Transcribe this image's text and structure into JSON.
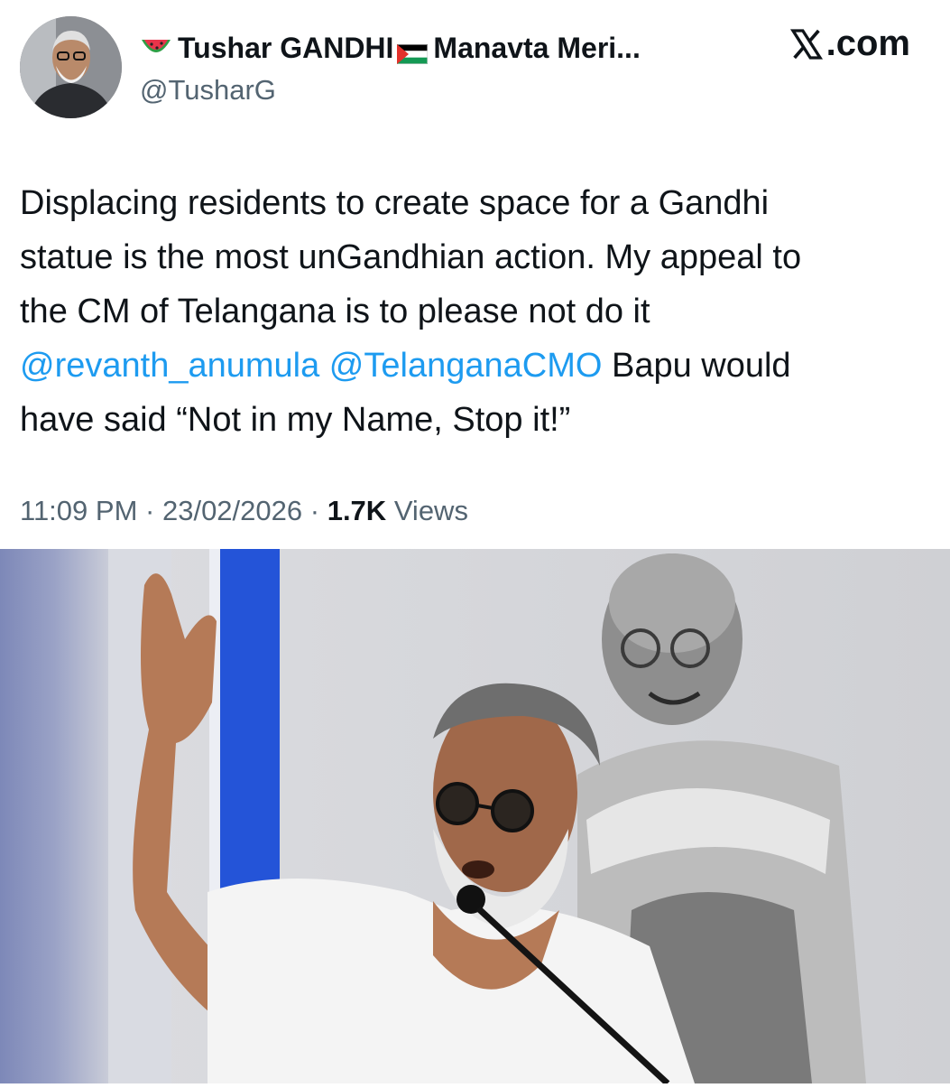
{
  "author": {
    "name_part1": "Tushar GANDHI",
    "name_part2": "Manavta Meri...",
    "handle": "@TusharG",
    "emoji_icon": "watermelon-icon",
    "flag_icon": "palestine-flag-icon"
  },
  "brand": {
    "label": ".com"
  },
  "tweet": {
    "line1": "Displacing residents to create space for a Gandhi",
    "line2": "statue is the most unGandhian action. My appeal to",
    "line3": "the CM of Telangana is to please not do it",
    "mention1": "@revanth_anumula",
    "mention2": "@TelanganaCMO",
    "line4_tail": "Bapu would",
    "line5": "have said “Not in my Name, Stop it!”"
  },
  "meta": {
    "time": "11:09 PM",
    "date": "23/02/2026",
    "views_count": "1.7K",
    "views_label": "Views",
    "separator": "·"
  },
  "colors": {
    "mention": "#1d9bf0",
    "secondary_text": "#536471",
    "primary_text": "#0f1419"
  }
}
